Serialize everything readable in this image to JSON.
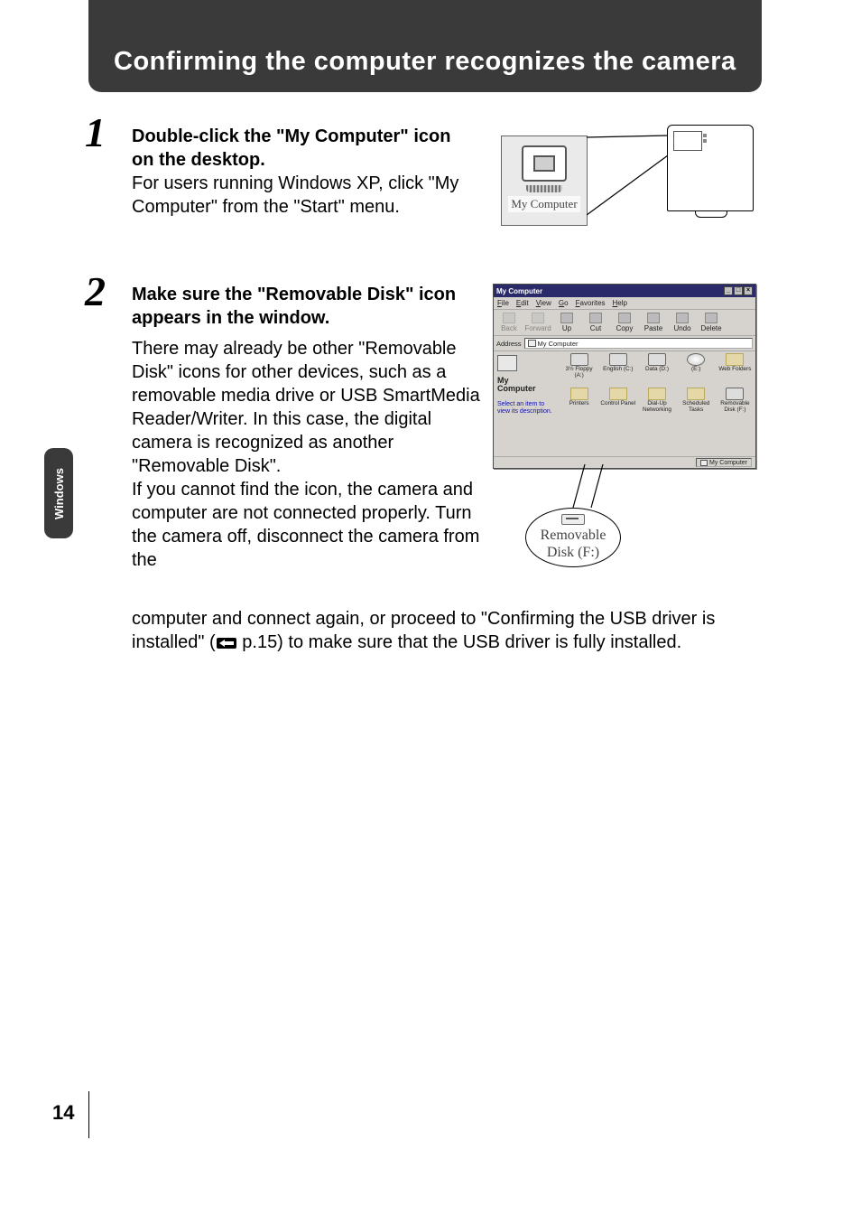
{
  "header": {
    "title": "Confirming the computer recognizes the camera"
  },
  "side_tab": {
    "label": "Windows"
  },
  "steps": {
    "one": {
      "num": "1",
      "heading": "Double-click the \"My Computer\" icon on the desktop.",
      "body": "For users running Windows XP, click \"My Computer\" from the \"Start\" menu."
    },
    "two": {
      "num": "2",
      "heading": "Make sure the \"Removable Disk\" icon appears in the window.",
      "p1": "There may already be other \"Removable Disk\" icons for other devices, such as a removable media drive or USB SmartMedia Reader/Writer. In this case, the digital camera is recognized as another \"Removable Disk\".",
      "p2": "If you cannot find the icon, the camera and computer are not connected properly. Turn the camera off, disconnect the camera from the",
      "tail_before_ref": "computer and connect again, or proceed to \"Confirming the USB driver is installed\" (",
      "tail_ref_text": " p.15) to make sure that the USB driver is fully installed."
    }
  },
  "illus1": {
    "label": "My Computer"
  },
  "win98": {
    "title": "My Computer",
    "menus": [
      "File",
      "Edit",
      "View",
      "Go",
      "Favorites",
      "Help"
    ],
    "toolbar": [
      {
        "label": "Back",
        "dim": true
      },
      {
        "label": "Forward",
        "dim": true
      },
      {
        "label": "Up",
        "dim": false
      },
      {
        "label": "Cut",
        "dim": false
      },
      {
        "label": "Copy",
        "dim": false
      },
      {
        "label": "Paste",
        "dim": false
      },
      {
        "label": "Undo",
        "dim": false
      },
      {
        "label": "Delete",
        "dim": false
      }
    ],
    "address_label": "Address",
    "address_value": "My Computer",
    "left_name_line1": "My",
    "left_name_line2": "Computer",
    "left_sub": "Select an item to view its description.",
    "drives": [
      {
        "label": "3½ Floppy (A:)",
        "kind": "hd"
      },
      {
        "label": "English (C:)",
        "kind": "hd"
      },
      {
        "label": "Data (D:)",
        "kind": "hd"
      },
      {
        "label": "(E:)",
        "kind": "cd"
      },
      {
        "label": "Web Folders",
        "kind": "fold"
      },
      {
        "label": "Printers",
        "kind": "fold"
      },
      {
        "label": "Control Panel",
        "kind": "fold"
      },
      {
        "label": "Dial-Up Networking",
        "kind": "fold"
      },
      {
        "label": "Scheduled Tasks",
        "kind": "fold"
      },
      {
        "label": "Removable Disk (F:)",
        "kind": "hd"
      }
    ],
    "status": "My Computer"
  },
  "callout": {
    "line1": "Removable",
    "line2": "Disk (F:)"
  },
  "page_number": "14"
}
